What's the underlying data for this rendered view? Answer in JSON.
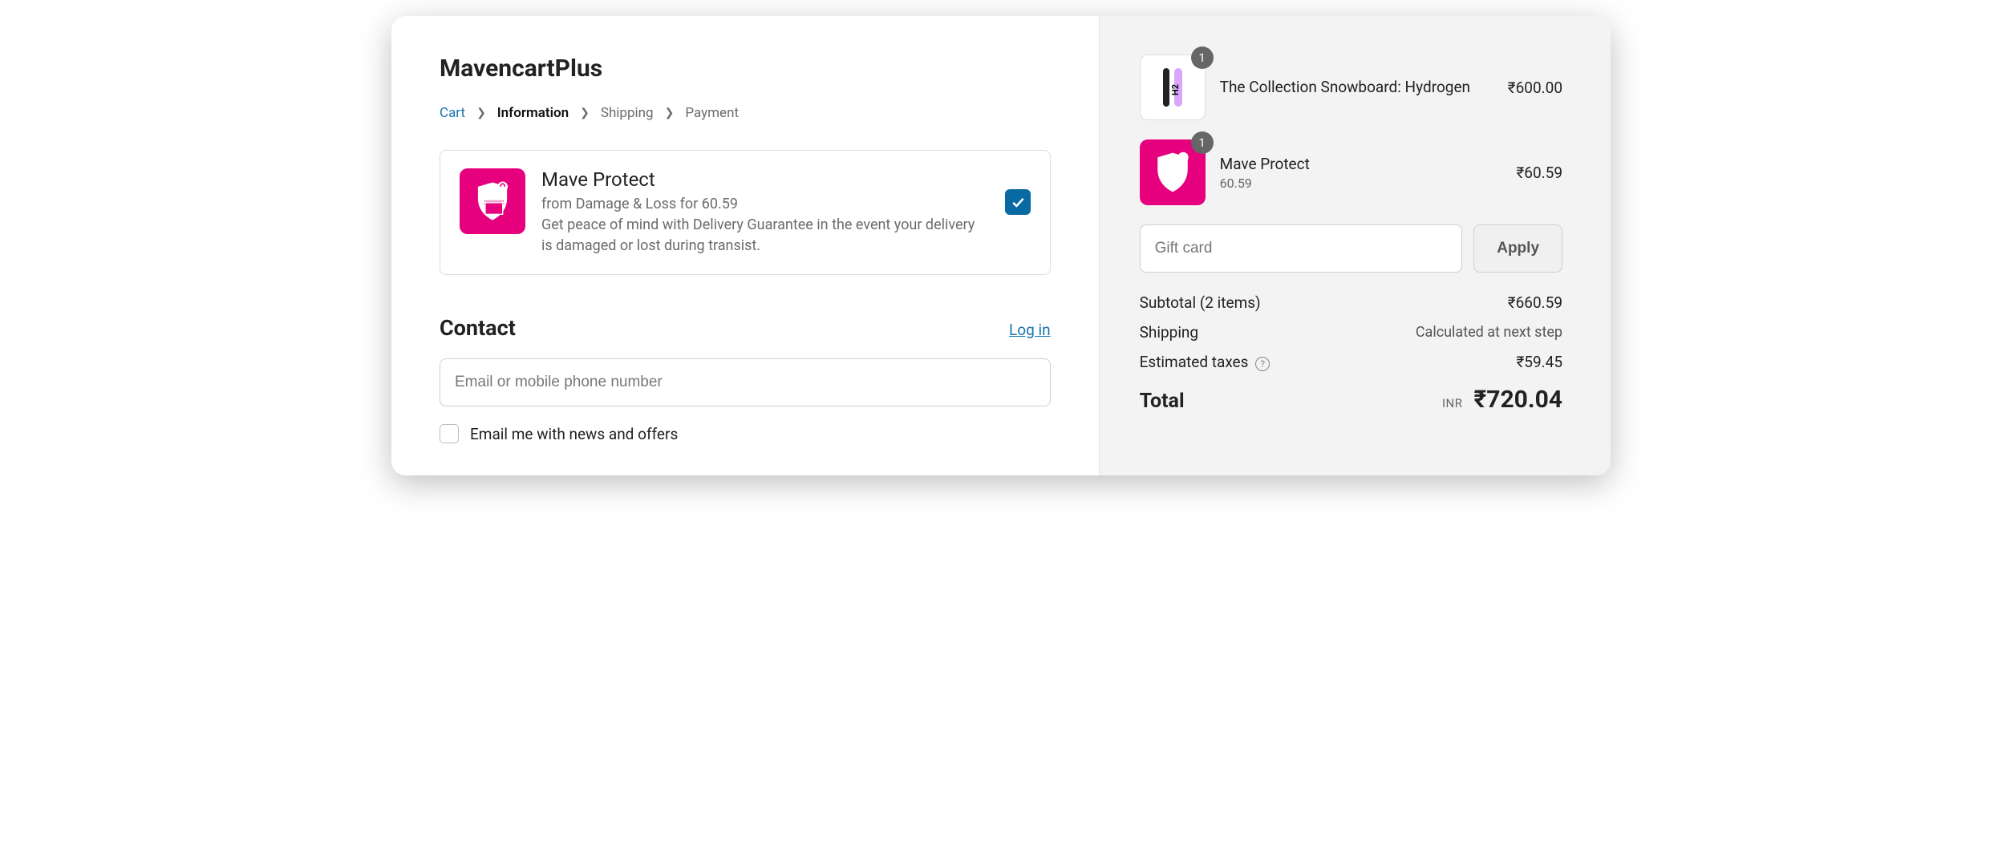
{
  "store_name": "MavencartPlus",
  "breadcrumb": {
    "cart": "Cart",
    "information": "Information",
    "shipping": "Shipping",
    "payment": "Payment"
  },
  "protect": {
    "title": "Mave Protect",
    "subtitle_line1": "from Damage & Loss for 60.59",
    "subtitle_line2": "Get peace of mind with Delivery Guarantee in the event your delivery is damaged or lost during transist."
  },
  "contact": {
    "heading": "Contact",
    "login": "Log in",
    "email_placeholder": "Email or mobile phone number",
    "newsletter_label": "Email me with news and offers"
  },
  "cart": {
    "items": [
      {
        "name": "The Collection Snowboard: Hydrogen",
        "variant": "",
        "qty": "1",
        "price": "₹600.00"
      },
      {
        "name": "Mave Protect",
        "variant": "60.59",
        "qty": "1",
        "price": "₹60.59"
      }
    ],
    "giftcard_placeholder": "Gift card",
    "apply_label": "Apply",
    "subtotal_label": "Subtotal (2 items)",
    "subtotal_value": "₹660.59",
    "shipping_label": "Shipping",
    "shipping_value": "Calculated at next step",
    "taxes_label": "Estimated taxes",
    "taxes_value": "₹59.45",
    "total_label": "Total",
    "total_currency": "INR",
    "total_value": "₹720.04"
  }
}
